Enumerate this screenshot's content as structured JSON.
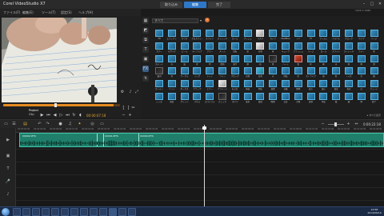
{
  "window": {
    "title": "Corel VideoStudio X7"
  },
  "menu": [
    "ファイル(F)",
    "編集(E)",
    "ツール(T)",
    "設定(S)",
    "ヘルプ(H)"
  ],
  "workspace_tabs": {
    "capture": "取り込み",
    "edit": "編集",
    "share": "完了",
    "active": "edit"
  },
  "project_info": "1920 X 1080",
  "player": {
    "project_label": "Project",
    "clip_label": "Clip",
    "timecode": "00:00:07:18"
  },
  "library": {
    "search_placeholder": "すべて",
    "status": "▸ すべて表示",
    "thumbs": [
      "3D",
      "エフェクト",
      "ガラス",
      "クロスフェード",
      "スライド",
      "ストレッチ",
      "ロール",
      "プッシュ",
      "マスク",
      "カメラ",
      "NewBlue",
      "ドア",
      "FX",
      "フィルム",
      "アルバム",
      "クロック",
      "ワイプ",
      "ページ",
      "カラー",
      "モザイク",
      "ピール",
      "ディゾルブ",
      "ブラー",
      "ズーム",
      "回転",
      "扉",
      "分割",
      "球",
      "キューブ",
      "フラッシュ",
      "ページ",
      "ロール",
      "スライド",
      "ストレッチ",
      "ライト",
      "星",
      "ステンド",
      "光",
      "波",
      "星",
      "円",
      "四角",
      "落下",
      "煙",
      "花",
      "黒",
      "ハート",
      "雲",
      "枠",
      "霧",
      "炎",
      "紙",
      "雨",
      "雪",
      "銀河",
      "泡",
      "サークル",
      "リング",
      "ドット",
      "ライン",
      "ブロック",
      "光線",
      "反射",
      "水",
      "回転",
      "形",
      "ストライプ",
      "帯",
      "粒",
      "ノイズ",
      "古",
      "鏡",
      "カーテン",
      "バンド",
      "ボックス",
      "フラップ",
      "ミラー",
      "ブラインド",
      "ねじれ",
      "伸縮",
      "押出",
      "展開",
      "分離",
      "開閉",
      "拡大",
      "縮小",
      "変形",
      "色彩",
      "白",
      "フェード",
      "レンズ",
      "視差",
      "グリッド",
      "パネル",
      "スパイラル",
      "チェック",
      "ダイヤ",
      "菱形",
      "旋回",
      "隙間",
      "交差",
      "対角",
      "放射",
      "中央",
      "縦",
      "横",
      "斜",
      "終了"
    ]
  },
  "timeline": {
    "ruler": [
      "00:00:00:00",
      "00:00:04:00",
      "00:00:08:00",
      "00:00:12:00",
      "00:00:16:00",
      "00:00:20:00",
      "00:00:24:00",
      "00:00:28:00",
      "00:00:32:00",
      "00:00:36:00",
      "00:00:40:00",
      "00:00:44:00",
      "00:00:48:00",
      "00:00:52:00",
      "00:00:56:00",
      "00:01:00:00",
      "00:01:04:00",
      "00:01:08:00",
      "00:01:12:00",
      "00:01:16:00",
      "00:01:20:00",
      "00:01:24:00",
      "00:01:28:00"
    ],
    "clips": [
      "00002.MTS",
      "00001.MTS",
      "00000.MTS"
    ],
    "time": "0:00:22:18"
  },
  "taskbar": {
    "clock_time": "22:58",
    "clock_date": "2014/09/10"
  },
  "colors": {
    "accent": "#2f78c8",
    "clip": "#1f7f6a",
    "scrub": "#e58a20"
  }
}
